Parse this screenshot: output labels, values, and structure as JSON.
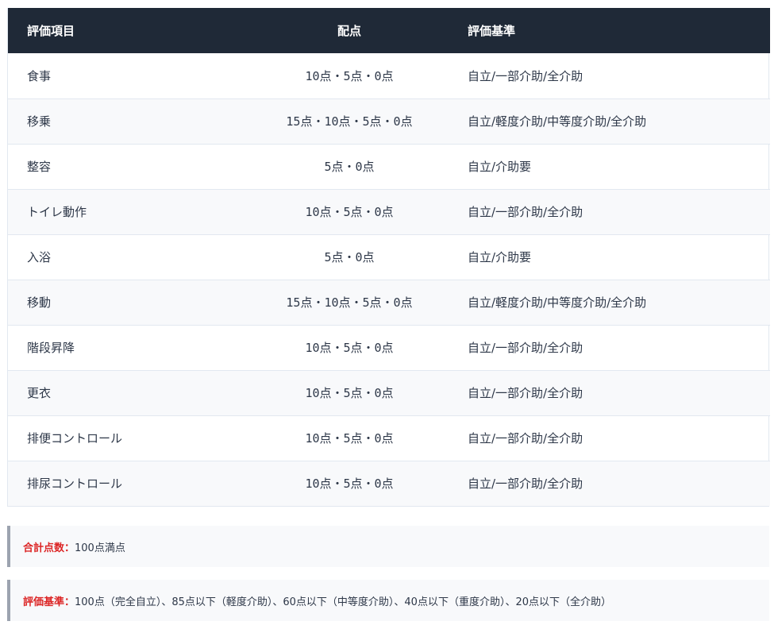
{
  "table": {
    "headers": {
      "item": "評価項目",
      "score": "配点",
      "criteria": "評価基準"
    },
    "rows": [
      {
        "item": "食事",
        "score": "10点・5点・0点",
        "criteria": "自立/一部介助/全介助"
      },
      {
        "item": "移乗",
        "score": "15点・10点・5点・0点",
        "criteria": "自立/軽度介助/中等度介助/全介助"
      },
      {
        "item": "整容",
        "score": "5点・0点",
        "criteria": "自立/介助要"
      },
      {
        "item": "トイレ動作",
        "score": "10点・5点・0点",
        "criteria": "自立/一部介助/全介助"
      },
      {
        "item": "入浴",
        "score": "5点・0点",
        "criteria": "自立/介助要"
      },
      {
        "item": "移動",
        "score": "15点・10点・5点・0点",
        "criteria": "自立/軽度介助/中等度介助/全介助"
      },
      {
        "item": "階段昇降",
        "score": "10点・5点・0点",
        "criteria": "自立/一部介助/全介助"
      },
      {
        "item": "更衣",
        "score": "10点・5点・0点",
        "criteria": "自立/一部介助/全介助"
      },
      {
        "item": "排便コントロール",
        "score": "10点・5点・0点",
        "criteria": "自立/一部介助/全介助"
      },
      {
        "item": "排尿コントロール",
        "score": "10点・5点・0点",
        "criteria": "自立/一部介助/全介助"
      }
    ]
  },
  "notes": {
    "total": {
      "label": "合計点数：",
      "text": "100点満点"
    },
    "criteria": {
      "label": "評価基準：",
      "text": "100点（完全自立）、85点以下（軽度介助）、60点以下（中等度介助）、40点以下（重度介助）、20点以下（全介助）"
    }
  },
  "colors": {
    "header_bg": "#1f2937",
    "label_red": "#dc2626",
    "note_border": "#9ca3af"
  }
}
